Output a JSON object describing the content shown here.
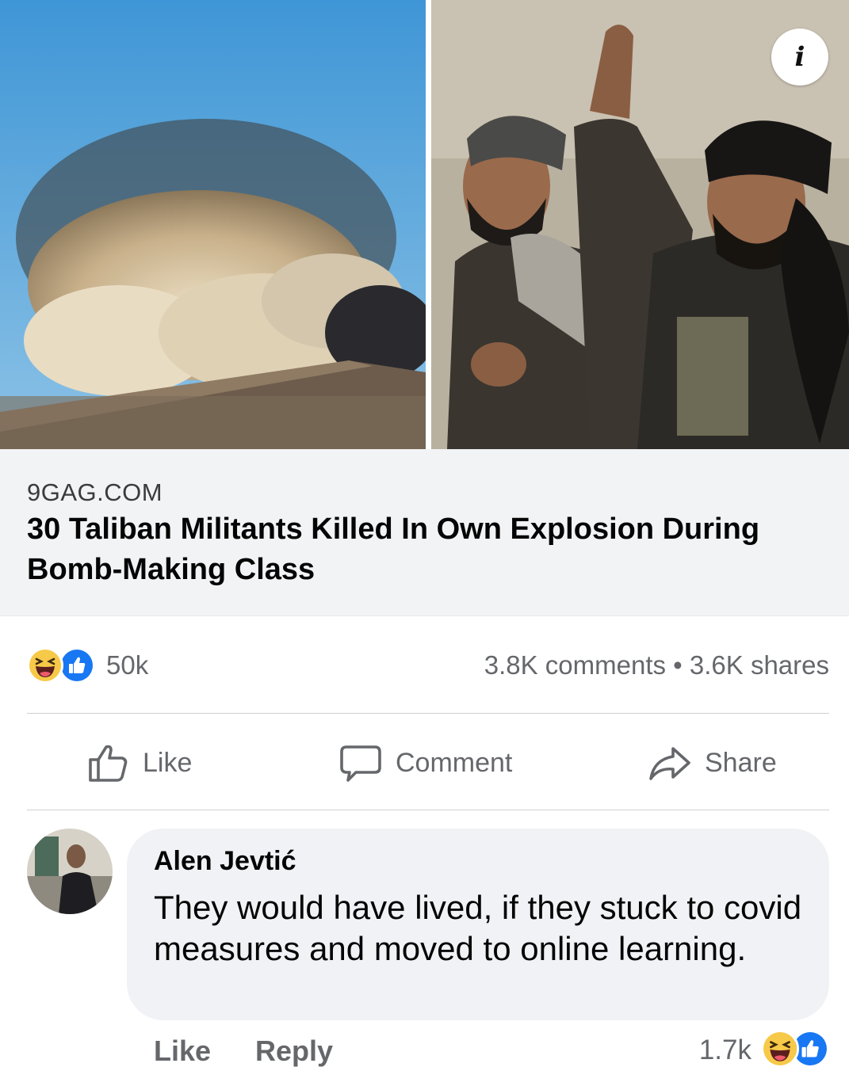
{
  "post": {
    "link_preview": {
      "domain": "9GAG.COM",
      "title": "30 Taliban Militants Killed In Own Explosion During Bomb-Making Class"
    },
    "info_icon": "info-icon",
    "reactions": {
      "icons": [
        "haha-reaction-icon",
        "like-reaction-icon"
      ],
      "count": "50k",
      "comments_shares": "3.8K comments • 3.6K shares"
    },
    "actions": {
      "like_label": "Like",
      "comment_label": "Comment",
      "share_label": "Share"
    }
  },
  "comment": {
    "author": "Alen Jevtić",
    "text": "They would have lived, if they stuck to covid measures and moved to online learning.",
    "like_label": "Like",
    "reply_label": "Reply",
    "reaction_count": "1.7k"
  },
  "colors": {
    "like_blue": "#1877f2",
    "haha_yellow": "#f7c948",
    "secondary_text": "#65676b",
    "bubble_bg": "#f0f2f5",
    "link_bg": "#f2f3f5"
  }
}
